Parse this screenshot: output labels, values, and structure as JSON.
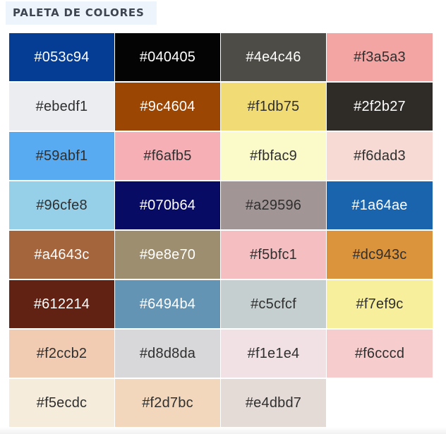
{
  "heading": "PALETA DE COLORES",
  "swatches": [
    {
      "hex": "#053c94",
      "label": "#053c94",
      "text": "light"
    },
    {
      "hex": "#040405",
      "label": "#040405",
      "text": "light"
    },
    {
      "hex": "#4e4c46",
      "label": "#4e4c46",
      "text": "light"
    },
    {
      "hex": "#f3a5a3",
      "label": "#f3a5a3",
      "text": "dark"
    },
    {
      "hex": "#ebedf1",
      "label": "#ebedf1",
      "text": "dark"
    },
    {
      "hex": "#9c4604",
      "label": "#9c4604",
      "text": "light"
    },
    {
      "hex": "#f1db75",
      "label": "#f1db75",
      "text": "dark"
    },
    {
      "hex": "#2f2b27",
      "label": "#2f2b27",
      "text": "light"
    },
    {
      "hex": "#59abf1",
      "label": "#59abf1",
      "text": "dark"
    },
    {
      "hex": "#f6afb5",
      "label": "#f6afb5",
      "text": "dark"
    },
    {
      "hex": "#fbfac9",
      "label": "#fbfac9",
      "text": "dark"
    },
    {
      "hex": "#f6dad3",
      "label": "#f6dad3",
      "text": "dark"
    },
    {
      "hex": "#96cfe8",
      "label": "#96cfe8",
      "text": "dark"
    },
    {
      "hex": "#070b64",
      "label": "#070b64",
      "text": "light"
    },
    {
      "hex": "#a29596",
      "label": "#a29596",
      "text": "dark"
    },
    {
      "hex": "#1a64ae",
      "label": "#1a64ae",
      "text": "light"
    },
    {
      "hex": "#a4643c",
      "label": "#a4643c",
      "text": "light"
    },
    {
      "hex": "#9e8e70",
      "label": "#9e8e70",
      "text": "light"
    },
    {
      "hex": "#f5bfc1",
      "label": "#f5bfc1",
      "text": "dark"
    },
    {
      "hex": "#dc943c",
      "label": "#dc943c",
      "text": "dark"
    },
    {
      "hex": "#612214",
      "label": "#612214",
      "text": "light"
    },
    {
      "hex": "#6494b4",
      "label": "#6494b4",
      "text": "light"
    },
    {
      "hex": "#c5cfcf",
      "label": "#c5cfcf",
      "text": "dark"
    },
    {
      "hex": "#f7ef9c",
      "label": "#f7ef9c",
      "text": "dark"
    },
    {
      "hex": "#f2ccb2",
      "label": "#f2ccb2",
      "text": "dark"
    },
    {
      "hex": "#d8d8da",
      "label": "#d8d8da",
      "text": "dark"
    },
    {
      "hex": "#f1e1e4",
      "label": "#f1e1e4",
      "text": "dark"
    },
    {
      "hex": "#f6cccd",
      "label": "#f6cccd",
      "text": "dark"
    },
    {
      "hex": "#f5ecdc",
      "label": "#f5ecdc",
      "text": "dark"
    },
    {
      "hex": "#f2d7bc",
      "label": "#f2d7bc",
      "text": "dark"
    },
    {
      "hex": "#e4dbd7",
      "label": "#e4dbd7",
      "text": "dark"
    }
  ]
}
